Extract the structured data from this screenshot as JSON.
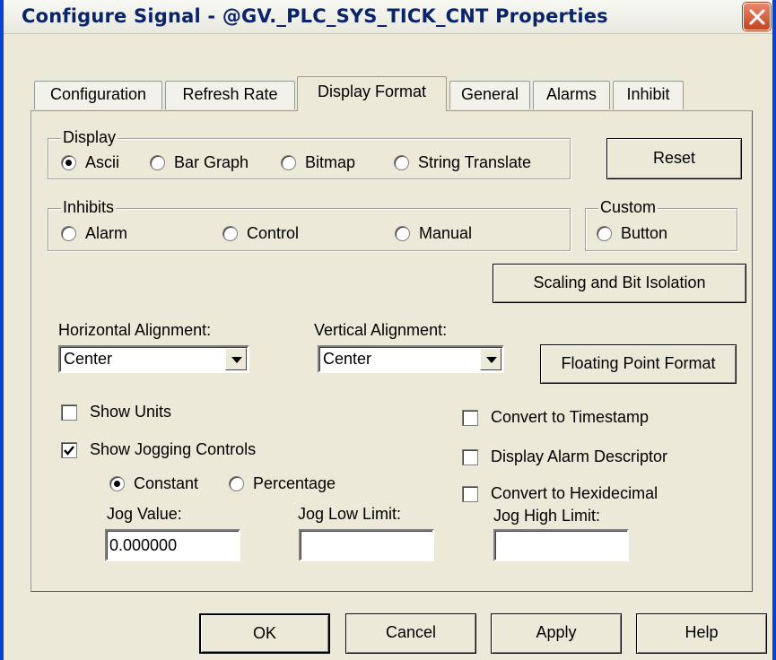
{
  "window": {
    "title": "Configure Signal - @GV._PLC_SYS_TICK_CNT Properties"
  },
  "tabs": [
    {
      "label": "Configuration",
      "active": false
    },
    {
      "label": "Refresh Rate",
      "active": false
    },
    {
      "label": "Display Format",
      "active": true
    },
    {
      "label": "General",
      "active": false
    },
    {
      "label": "Alarms",
      "active": false
    },
    {
      "label": "Inhibit",
      "active": false
    }
  ],
  "display_group": {
    "legend": "Display",
    "options": [
      "Ascii",
      "Bar Graph",
      "Bitmap",
      "String Translate"
    ],
    "selected": "Ascii"
  },
  "reset_label": "Reset",
  "inhibits_group": {
    "legend": "Inhibits",
    "options": [
      "Alarm",
      "Control",
      "Manual"
    ]
  },
  "custom_group": {
    "legend": "Custom",
    "option": "Button"
  },
  "scaling_label": "Scaling and Bit Isolation",
  "horizontal_alignment": {
    "label": "Horizontal Alignment:",
    "value": "Center"
  },
  "vertical_alignment": {
    "label": "Vertical Alignment:",
    "value": "Center"
  },
  "floating_point_label": "Floating Point Format",
  "checks": {
    "show_units": {
      "label": "Show Units",
      "checked": false
    },
    "show_jogging": {
      "label": "Show Jogging Controls",
      "checked": true
    },
    "convert_timestamp": {
      "label": "Convert to Timestamp",
      "checked": false
    },
    "display_alarm_descriptor": {
      "label": "Display Alarm Descriptor",
      "checked": false
    },
    "convert_hex": {
      "label": "Convert to Hexidecimal",
      "checked": false
    }
  },
  "jog_mode": {
    "options": [
      "Constant",
      "Percentage"
    ],
    "selected": "Constant"
  },
  "jog_value": {
    "label": "Jog Value:",
    "value": "0.000000"
  },
  "jog_low": {
    "label": "Jog Low Limit:",
    "value": ""
  },
  "jog_high": {
    "label": "Jog High Limit:",
    "value": ""
  },
  "buttons": {
    "ok": "OK",
    "cancel": "Cancel",
    "apply": "Apply",
    "help": "Help"
  },
  "colors": {
    "title_text": "#0a246a",
    "frame_border": "#0841d6",
    "dialog_bg": "#ece9d8",
    "close_button": "#c6441e"
  }
}
